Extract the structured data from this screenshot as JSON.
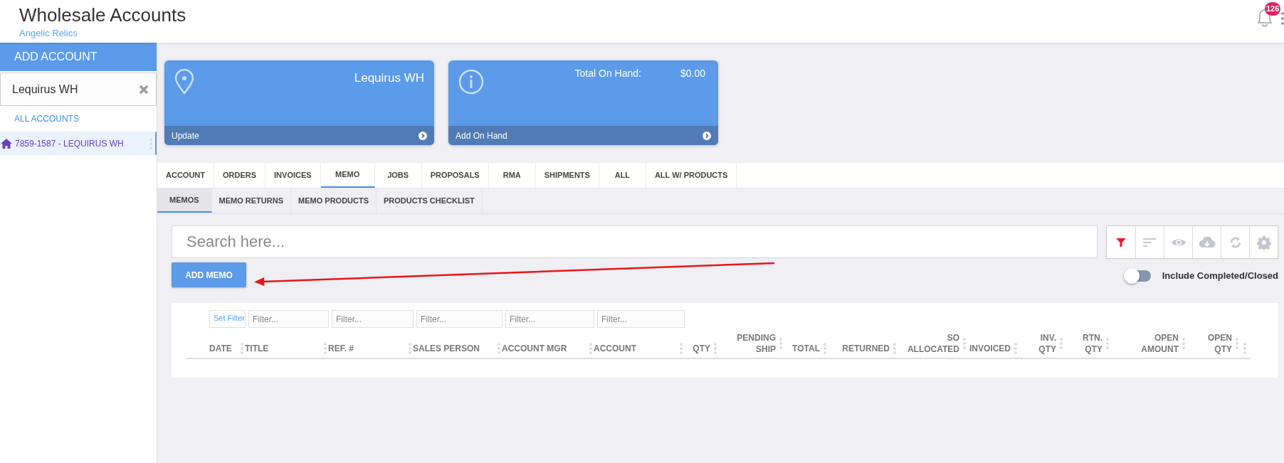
{
  "header": {
    "title": "Wholesale Accounts",
    "subtitle": "Angelic Relics",
    "notification_count": "126"
  },
  "sidebar": {
    "add_button": "ADD ACCOUNT",
    "search": {
      "value": "Lequirus WH"
    },
    "all_link": "ALL ACCOUNTS",
    "items": [
      {
        "label": "7859-1587 - LEQUIRUS WH",
        "selected": true
      }
    ]
  },
  "cards": [
    {
      "kind": "location",
      "title": "Lequirus WH",
      "action": "Update"
    },
    {
      "kind": "info",
      "label": "Total On Hand:",
      "value": "$0.00",
      "action": "Add On Hand"
    }
  ],
  "tabs": [
    {
      "label": "ACCOUNT",
      "selected": false
    },
    {
      "label": "ORDERS",
      "selected": false
    },
    {
      "label": "INVOICES",
      "selected": false
    },
    {
      "label": "MEMO",
      "selected": true
    },
    {
      "label": "JOBS",
      "selected": false
    },
    {
      "label": "PROPOSALS",
      "selected": false
    },
    {
      "label": "RMA",
      "selected": false
    },
    {
      "label": "SHIPMENTS",
      "selected": false
    },
    {
      "label": "ALL",
      "selected": false
    },
    {
      "label": "ALL W/ PRODUCTS",
      "selected": false
    }
  ],
  "subtabs": [
    {
      "label": "MEMOS",
      "selected": true
    },
    {
      "label": "MEMO RETURNS",
      "selected": false
    },
    {
      "label": "MEMO PRODUCTS",
      "selected": false
    },
    {
      "label": "PRODUCTS CHECKLIST",
      "selected": false
    }
  ],
  "search": {
    "placeholder": "Search here..."
  },
  "toolbar": [
    {
      "kind": "filter",
      "active": true
    },
    {
      "kind": "sort",
      "active": false
    },
    {
      "kind": "view",
      "active": false
    },
    {
      "kind": "download",
      "active": false
    },
    {
      "kind": "refresh",
      "active": false
    },
    {
      "kind": "settings",
      "active": false
    }
  ],
  "add_button": "ADD MEMO",
  "toggle": {
    "label": "Include Completed/Closed",
    "on": false
  },
  "table": {
    "filters": [
      {
        "kind": "link",
        "text": "Set Filter"
      },
      {
        "kind": "input",
        "placeholder": "Filter..."
      },
      {
        "kind": "input",
        "placeholder": "Filter..."
      },
      {
        "kind": "input",
        "placeholder": "Filter..."
      },
      {
        "kind": "input",
        "placeholder": "Filter..."
      },
      {
        "kind": "input",
        "placeholder": "Filter..."
      }
    ],
    "columns": [
      {
        "label": "DATE",
        "kind": "text"
      },
      {
        "label": "TITLE",
        "kind": "text"
      },
      {
        "label": "REF. #",
        "kind": "text"
      },
      {
        "label": "SALES PERSON",
        "kind": "text"
      },
      {
        "label": "ACCOUNT MGR",
        "kind": "text"
      },
      {
        "label": "ACCOUNT",
        "kind": "text"
      },
      {
        "label": "QTY",
        "kind": "numeric"
      },
      {
        "label": "PENDING SHIP",
        "kind": "numeric"
      },
      {
        "label": "TOTAL",
        "kind": "numeric"
      },
      {
        "label": "RETURNED",
        "kind": "numeric"
      },
      {
        "label": "SO ALLOCATED",
        "kind": "numeric"
      },
      {
        "label": "INVOICED",
        "kind": "numeric"
      },
      {
        "label": "INV. QTY",
        "kind": "numeric"
      },
      {
        "label": "RTN. QTY",
        "kind": "numeric"
      },
      {
        "label": "OPEN AMOUNT",
        "kind": "numeric"
      },
      {
        "label": "OPEN QTY",
        "kind": "numeric"
      }
    ]
  }
}
